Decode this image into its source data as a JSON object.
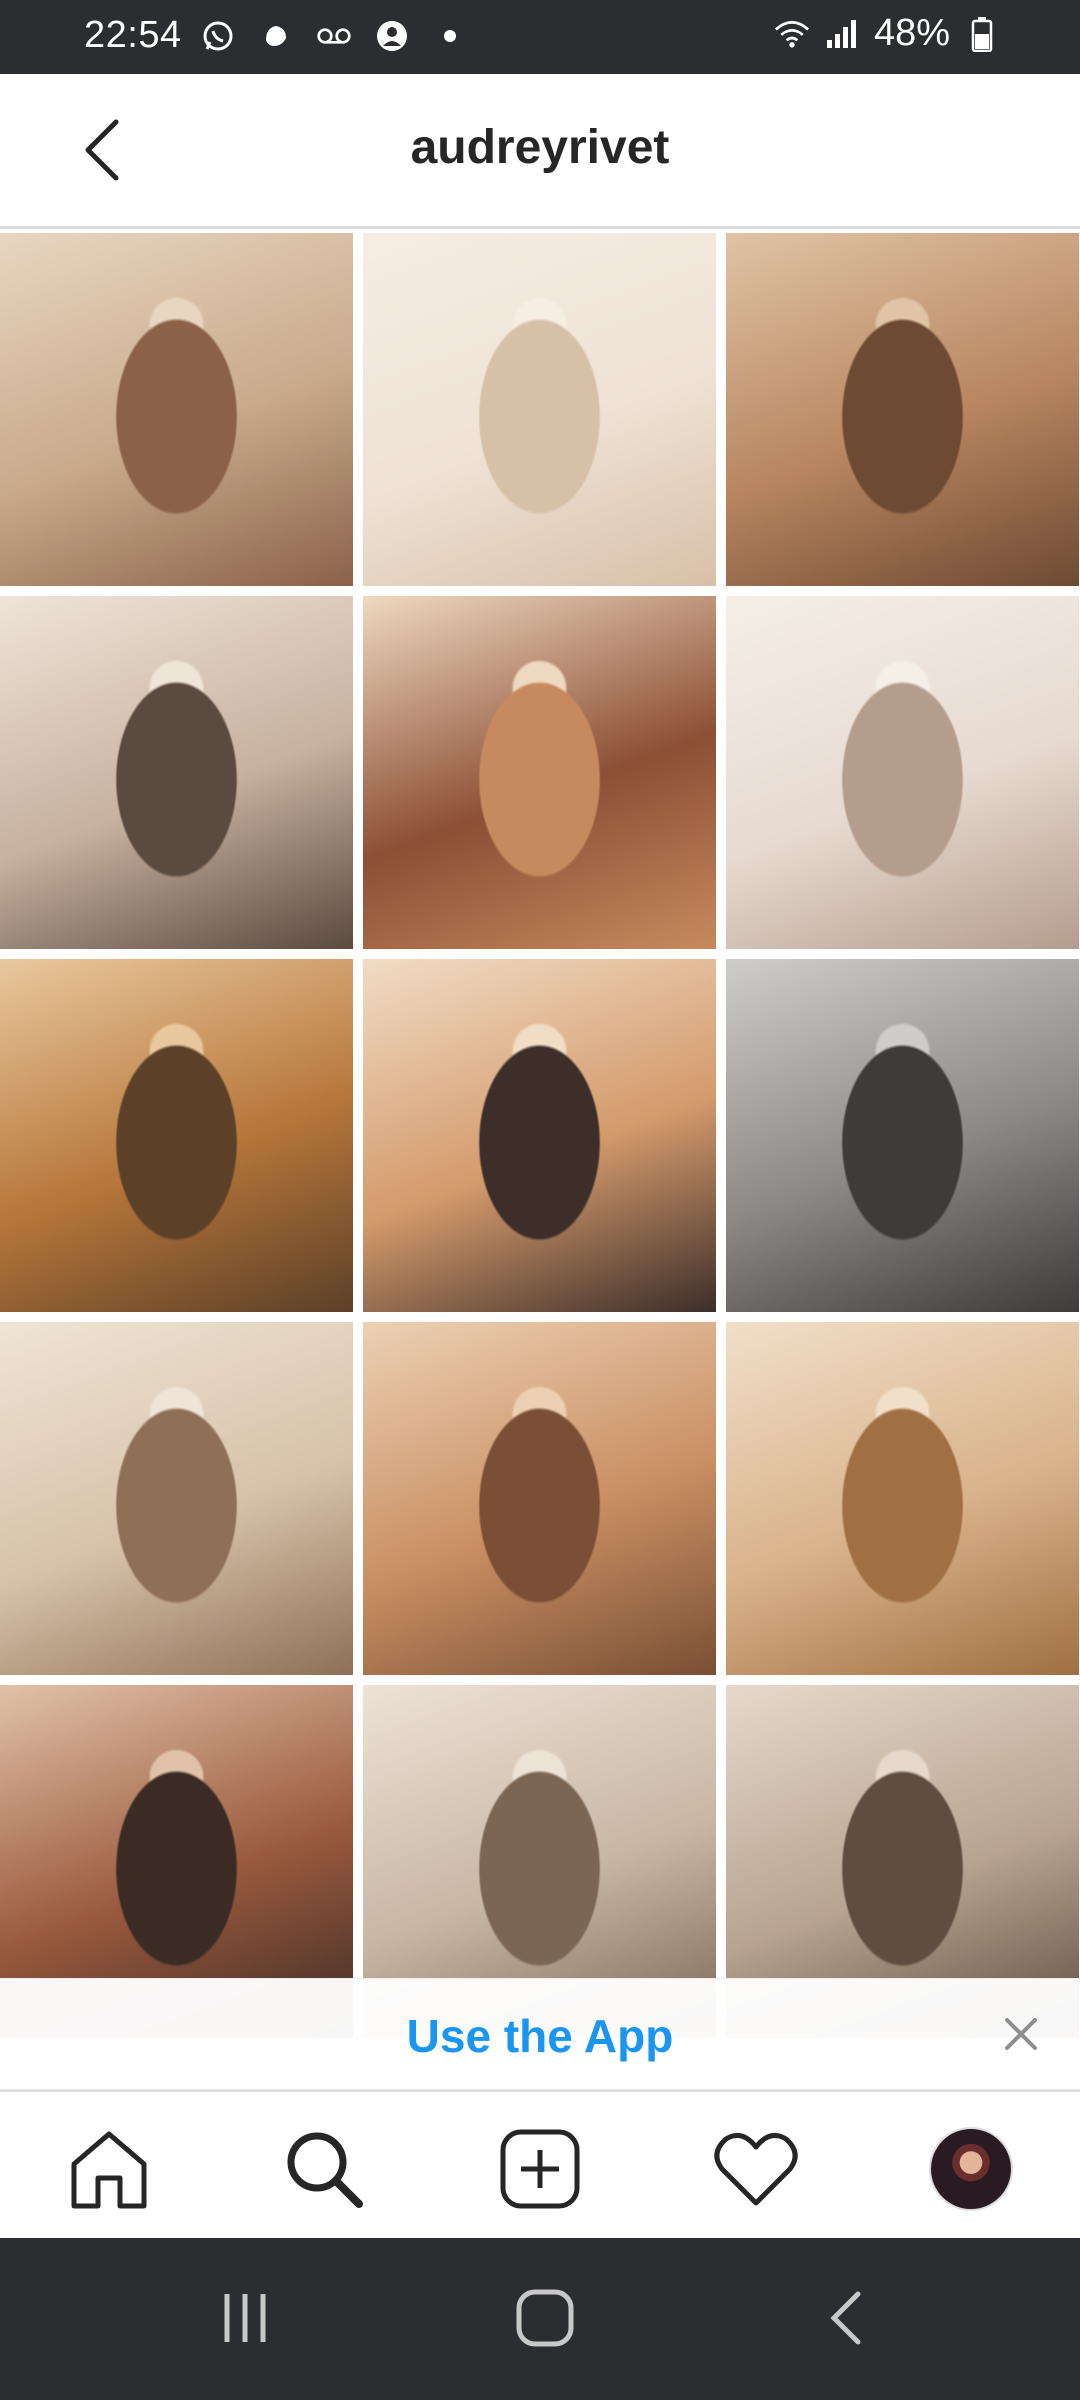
{
  "status_bar": {
    "time": "22:54",
    "battery_text": "48%",
    "icons": [
      "whatsapp-icon",
      "app-icon",
      "voicemail-icon",
      "account-icon",
      "dot-icon",
      "wifi-icon",
      "signal-icon",
      "battery-icon"
    ]
  },
  "header": {
    "title": "audreyrivet",
    "back_icon": "chevron-left-icon"
  },
  "grid": {
    "posts": [
      {
        "name": "post-dinner-party",
        "colors": [
          "#c9a98a",
          "#8b6248",
          "#e8d6c1"
        ]
      },
      {
        "name": "post-fireplace-silk-dress",
        "colors": [
          "#efe2d5",
          "#d7c0a8",
          "#f6ede3"
        ]
      },
      {
        "name": "post-puppy-street",
        "colors": [
          "#b88560",
          "#6e4a33",
          "#e0c4a5"
        ]
      },
      {
        "name": "post-coffee-street",
        "colors": [
          "#c7b1a0",
          "#5b4a3f",
          "#efe4d8"
        ]
      },
      {
        "name": "post-croissant-table",
        "colors": [
          "#8d4f35",
          "#c78a5e",
          "#eed9c0"
        ]
      },
      {
        "name": "post-bedroom-sweater",
        "colors": [
          "#e7dad0",
          "#b59d8d",
          "#f5efe8"
        ]
      },
      {
        "name": "post-lake-picnic",
        "colors": [
          "#b7763a",
          "#5c4028",
          "#e9c89e"
        ]
      },
      {
        "name": "post-staircase-dog",
        "colors": [
          "#d49a6c",
          "#3d2e2a",
          "#f1dcc5"
        ]
      },
      {
        "name": "post-bw-chair",
        "colors": [
          "#8b8886",
          "#3e3c3b",
          "#cfcdcb"
        ]
      },
      {
        "name": "post-bathtub",
        "colors": [
          "#d7c2a9",
          "#8e7058",
          "#efe4d6"
        ]
      },
      {
        "name": "post-telephone",
        "colors": [
          "#c98f63",
          "#7a4f35",
          "#edd0b4"
        ]
      },
      {
        "name": "post-jewelry-book",
        "colors": [
          "#d9b28a",
          "#a06f44",
          "#f1dfc9"
        ]
      },
      {
        "name": "post-wood-stove",
        "colors": [
          "#9b5a3e",
          "#3c2b25",
          "#e1c2a8"
        ]
      },
      {
        "name": "post-hat-book",
        "colors": [
          "#c8b6a4",
          "#7b6654",
          "#ede2d6"
        ]
      },
      {
        "name": "post-3927-doorway",
        "colors": [
          "#b8a491",
          "#5f4d40",
          "#e6d9cb"
        ]
      }
    ]
  },
  "banner": {
    "label": "Use the App",
    "close_icon": "close-icon",
    "color": "#1a95f0"
  },
  "bottom_nav": {
    "items": [
      "home-icon",
      "search-icon",
      "new-post-icon",
      "activity-heart-icon",
      "profile-avatar"
    ]
  },
  "system_nav": {
    "items": [
      "recents-icon",
      "home-circle-icon",
      "back-icon"
    ]
  }
}
